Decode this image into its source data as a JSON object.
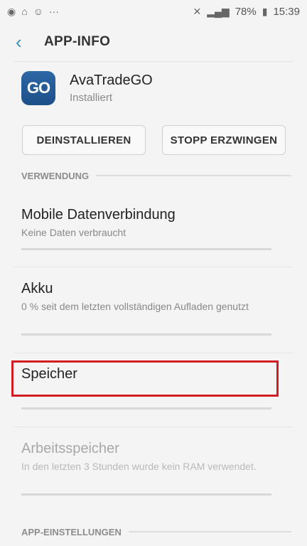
{
  "status_bar": {
    "battery": "78%",
    "time": "15:39",
    "dots": "···"
  },
  "header": {
    "back_icon": "‹",
    "title": "APP-INFO"
  },
  "app": {
    "icon_text": "GO",
    "name": "AvaTradeGO",
    "status": "Installiert"
  },
  "buttons": {
    "uninstall": "DEINSTALLIEREN",
    "force_stop": "STOPP ERZWINGEN"
  },
  "sections": {
    "usage": "VERWENDUNG",
    "app_settings": "APP-EINSTELLUNGEN"
  },
  "items": [
    {
      "title": "Mobile Datenverbindung",
      "subtitle": "Keine Daten verbraucht"
    },
    {
      "title": "Akku",
      "subtitle": "0 % seit dem letzten vollständigen Aufladen genutzt"
    },
    {
      "title": "Speicher",
      "subtitle": ""
    },
    {
      "title": "Arbeitsspeicher",
      "subtitle": "In den letzten 3 Stunden wurde kein RAM verwendet."
    }
  ]
}
